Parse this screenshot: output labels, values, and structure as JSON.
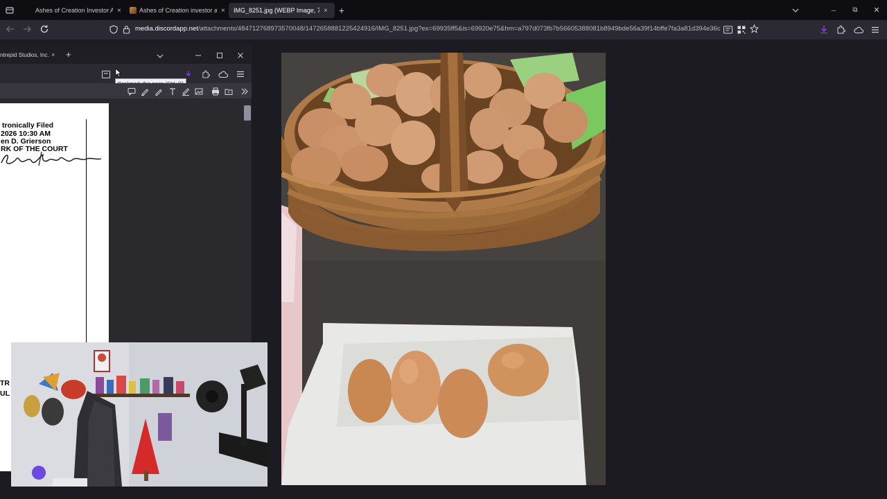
{
  "tabs": [
    {
      "title": "Ashes of Creation Investor Alle",
      "close": "×"
    },
    {
      "title": "Ashes of Creation investor accu",
      "close": "×"
    },
    {
      "title": "IMG_8251.jpg (WEBP Image, 703 ×",
      "close": "×"
    }
  ],
  "new_tab": "+",
  "window_controls": {
    "minimize": "─",
    "restore": "⧉",
    "close": "✕"
  },
  "url": {
    "host": "media.discordapp.net",
    "path": "/attachments/484712768973570048/1472658881225424916/IMG_8251.jpg?ex=69935ff5&is=69920e75&hm=a797d073fb7b56605388081b8949bde56a39f14bffe7fa3a81d394e36c05413c"
  },
  "inner_window": {
    "tab_title": "ntrepid Studios, Inc.",
    "tab_close": "×",
    "new_tab": "+",
    "tooltip": "Bookmark this page (Ctrl+D)",
    "pdf_lines": [
      "tronically Filed",
      "2026 10:30 AM",
      "en D. Grierson",
      "RK OF THE COURT"
    ],
    "pdf_lower": [
      "TR",
      "UL"
    ],
    "signature": "Steven D. Grierson"
  },
  "colors": {
    "accent_purple": "#7b3fe4",
    "tab_bg": "#0e0d12",
    "toolbar": "#2b2a33"
  },
  "icons": [
    "tab-list-icon",
    "back-icon",
    "forward-icon",
    "reload-icon",
    "shield-icon",
    "lock-icon",
    "download-icon",
    "bookmark-star-icon",
    "extensions-icon",
    "menu-icon"
  ]
}
